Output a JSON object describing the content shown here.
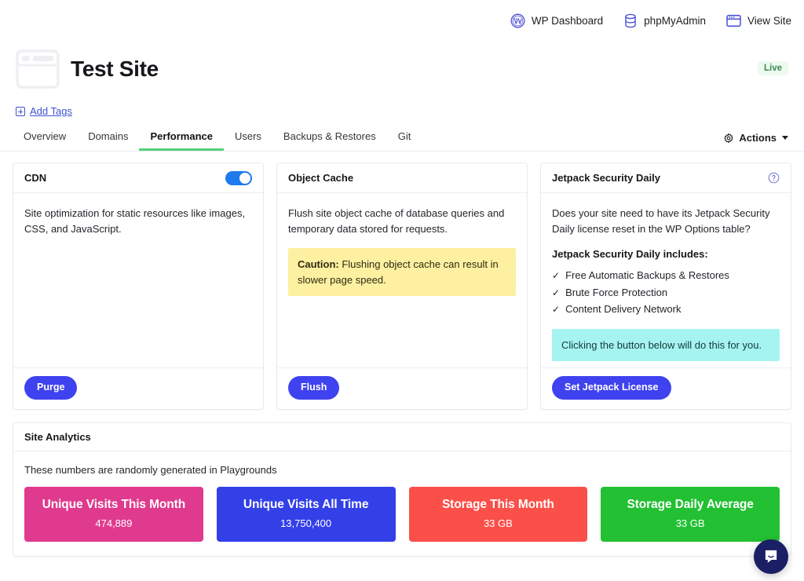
{
  "topbar": {
    "links": [
      {
        "label": "WP Dashboard",
        "icon": "wordpress-icon"
      },
      {
        "label": "phpMyAdmin",
        "icon": "database-icon"
      },
      {
        "label": "View Site",
        "icon": "browser-window-icon"
      }
    ]
  },
  "site": {
    "title": "Test Site",
    "status": "Live",
    "icon": "browser-window-icon",
    "add_tags_label": "Add Tags"
  },
  "tabs": [
    {
      "label": "Overview",
      "active": false
    },
    {
      "label": "Domains",
      "active": false
    },
    {
      "label": "Performance",
      "active": true
    },
    {
      "label": "Users",
      "active": false
    },
    {
      "label": "Backups & Restores",
      "active": false
    },
    {
      "label": "Git",
      "active": false
    }
  ],
  "actions": {
    "label": "Actions",
    "icon": "gear-icon"
  },
  "cards": {
    "cdn": {
      "title": "CDN",
      "toggle_on": true,
      "description": "Site optimization for static resources like images, CSS, and JavaScript.",
      "button": "Purge"
    },
    "object_cache": {
      "title": "Object Cache",
      "description": "Flush site object cache of database queries and temporary data stored for requests.",
      "caution_label": "Caution:",
      "caution_text": " Flushing object cache can result in slower page speed.",
      "button": "Flush"
    },
    "jetpack": {
      "title": "Jetpack Security Daily",
      "help_icon": "question-circle-icon",
      "description": "Does your site need to have its Jetpack Security Daily license reset in the WP Options table?",
      "includes_title": "Jetpack Security Daily includes:",
      "features": [
        "Free Automatic Backups & Restores",
        "Brute Force Protection",
        "Content Delivery Network"
      ],
      "info_text": "Clicking the button below will do this for you.",
      "button": "Set Jetpack License"
    }
  },
  "analytics": {
    "title": "Site Analytics",
    "note": "These numbers are randomly generated in Playgrounds",
    "stats": [
      {
        "label": "Unique Visits This Month",
        "value": "474,889",
        "color": "#e03a8e"
      },
      {
        "label": "Unique Visits All Time",
        "value": "13,750,400",
        "color": "#3340e8"
      },
      {
        "label": "Storage This Month",
        "value": "33 GB",
        "color": "#fb4f49"
      },
      {
        "label": "Storage Daily Average",
        "value": "33 GB",
        "color": "#22c032"
      }
    ]
  },
  "chat": {
    "icon": "chat-bubble-icon"
  },
  "colors": {
    "accent_blue": "#3f42ef",
    "toggle_blue": "#1f7aed",
    "tab_active_underline": "#54d17a",
    "link": "#3f51d6",
    "caution_bg": "#fdf0a0",
    "info_bg": "#a6f4f2",
    "live_text": "#3a8a4f"
  }
}
